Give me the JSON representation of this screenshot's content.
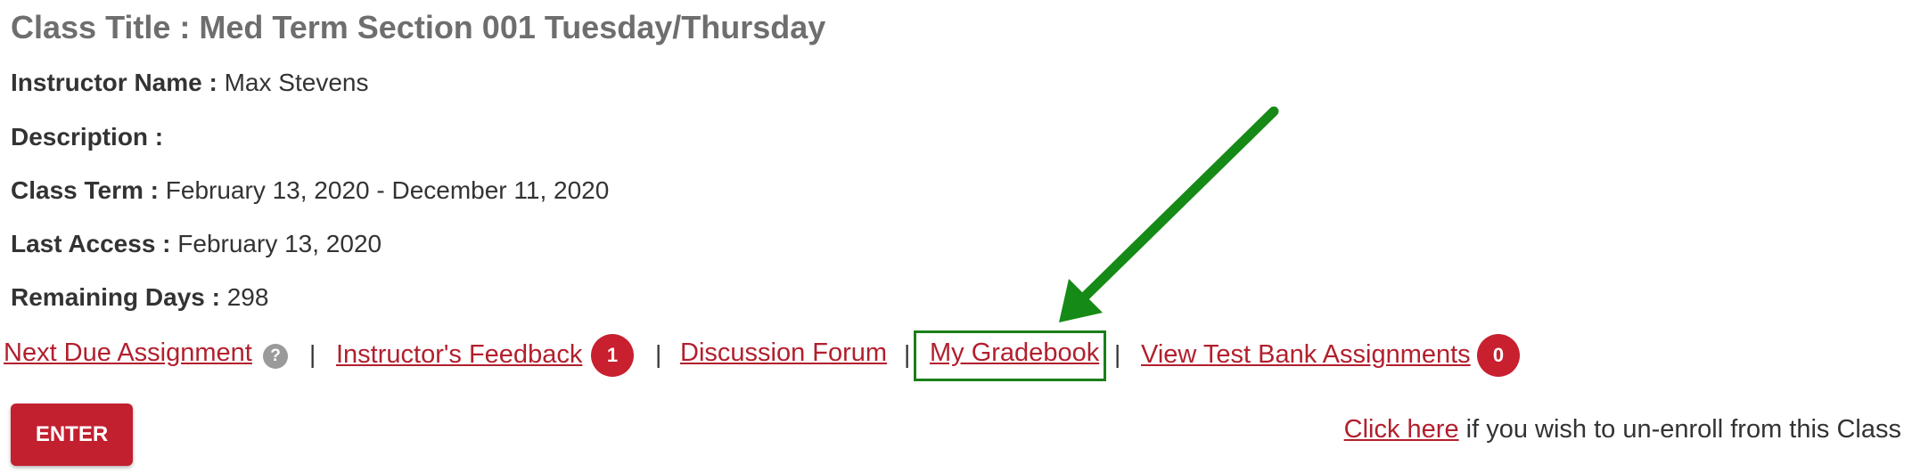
{
  "class": {
    "title": "Class Title : Med Term Section 001 Tuesday/Thursday"
  },
  "info": {
    "instructor_label": "Instructor Name :",
    "instructor_value": "Max Stevens",
    "description_label": "Description :",
    "description_value": "",
    "term_label": "Class Term :",
    "term_value": "February 13, 2020 - December 11, 2020",
    "last_access_label": "Last Access :",
    "last_access_value": "February 13, 2020",
    "remaining_label": "Remaining Days :",
    "remaining_value": "298"
  },
  "links": {
    "next_due": "Next Due Assignment",
    "help_glyph": "?",
    "separator": "|",
    "feedback": "Instructor's Feedback",
    "feedback_count": "1",
    "forum": "Discussion Forum",
    "gradebook": "My Gradebook",
    "test_bank": "View Test Bank Assignments",
    "test_bank_count": "0"
  },
  "actions": {
    "enter_label": "ENTER",
    "unenroll_link": "Click here",
    "unenroll_text": " if you wish to un-enroll from this Class"
  },
  "annotation": {
    "arrow_color": "#168a16",
    "highlight_color": "#1a7f1a"
  },
  "colors": {
    "accent": "#c21f2f",
    "link": "#b21f2d",
    "title": "#6e6e6e"
  }
}
